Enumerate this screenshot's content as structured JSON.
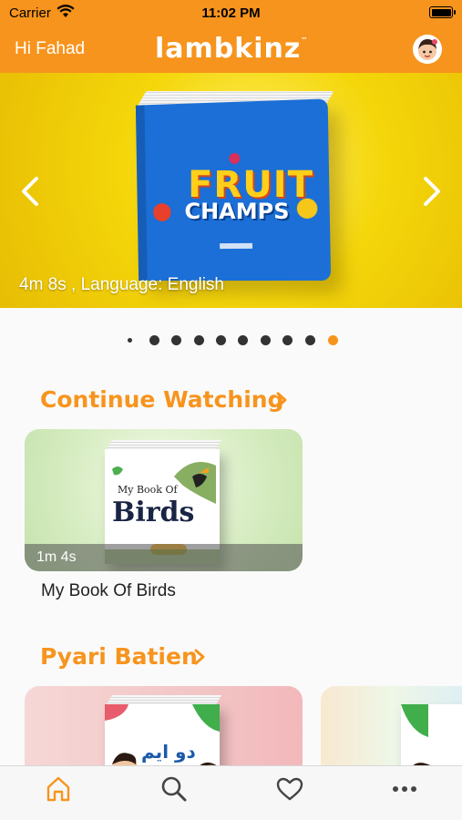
{
  "status_bar": {
    "carrier": "Carrier",
    "time": "11:02 PM"
  },
  "header": {
    "greeting": "Hi Fahad",
    "brand": "lambkinz",
    "brand_mark": "™"
  },
  "hero": {
    "book_title_line1": "FRUIT",
    "book_title_line2": "CHAMPS",
    "caption": "4m 8s , Language: English",
    "page_count": 10,
    "active_page": 10
  },
  "sections": {
    "continue_watching": {
      "title": "Continue Watching",
      "items": [
        {
          "book_title": "My Book Of",
          "book_title_big": "Birds",
          "duration": "1m 4s",
          "title": "My Book Of Birds"
        }
      ]
    },
    "pyari_batien": {
      "title": "Pyari Batien",
      "items": [
        {
          "book_title": "دو ایم"
        }
      ]
    }
  },
  "tabbar": {
    "tabs": [
      "home",
      "search",
      "favorites",
      "more"
    ],
    "active": "home"
  },
  "colors": {
    "accent": "#f7941d",
    "hero_bg": "#f4d60a",
    "book_blue": "#1b6fd6"
  }
}
